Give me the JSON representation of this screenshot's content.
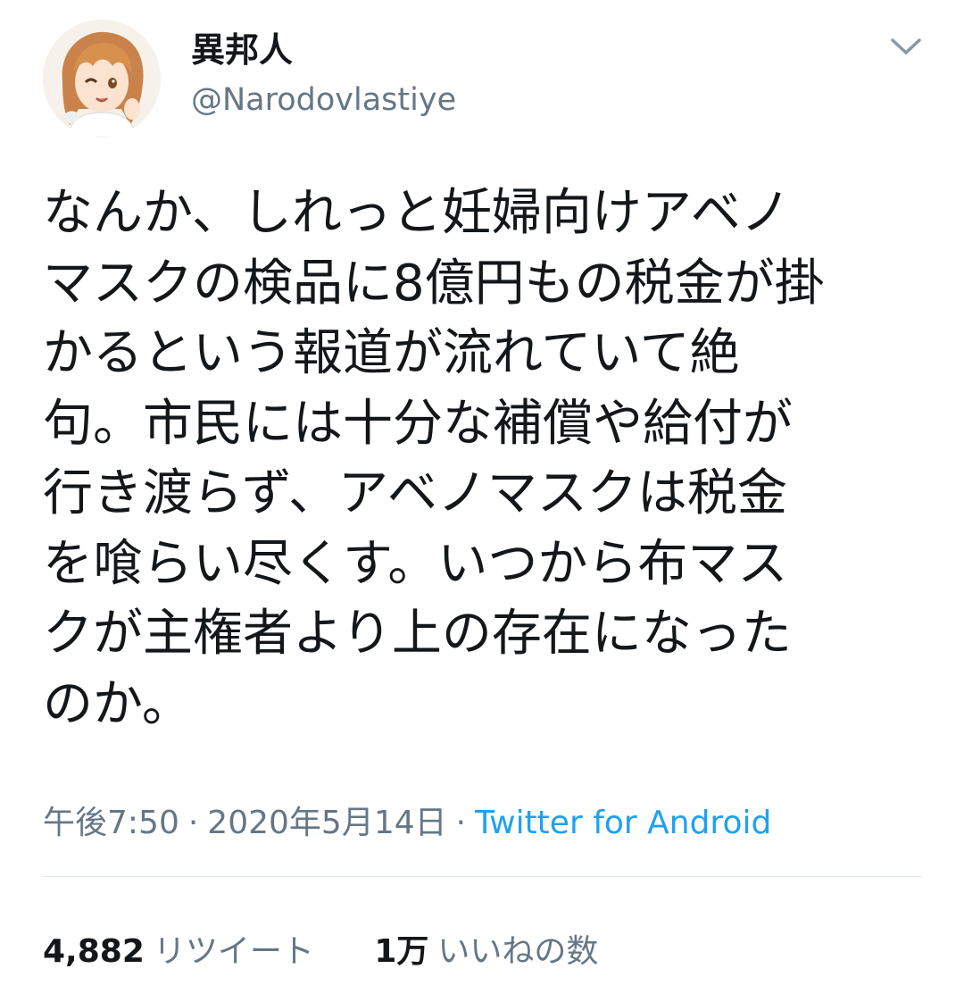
{
  "tweet": {
    "author": {
      "display_name": "異邦人",
      "handle": "@Narodovlastiye"
    },
    "text": "なんか、しれっと妊婦向けアベノ\nマスクの検品に8億円もの税金が掛\nかるという報道が流れていて絶\n句。市民には十分な補償や給付が\n行き渡らず、アベノマスクは税金\nを喰らい尽くす。いつから布マス\nクが主権者より上の存在になった\nのか。",
    "time": "午後7:50",
    "date": "2020年5月14日",
    "separator": "·",
    "source": "Twitter for Android",
    "stats": {
      "retweets_count": "4,882",
      "retweets_label": "リツイート",
      "likes_count": "1万",
      "likes_label": "いいねの数"
    }
  },
  "icons": {
    "menu": "chevron-down-icon",
    "avatar": "anime-girl-avatar"
  },
  "colors": {
    "text": "#14171a",
    "secondary": "#657786",
    "link": "#1da1f2",
    "divider": "#e1e8ed",
    "background": "#ffffff"
  }
}
